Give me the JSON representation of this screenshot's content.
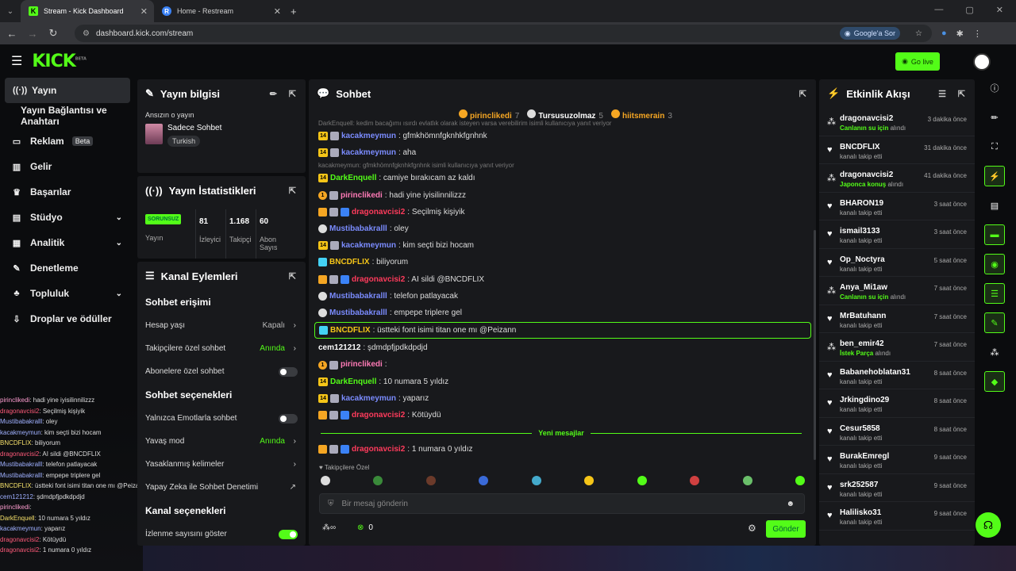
{
  "browser": {
    "tabs": [
      {
        "label": "Stream - Kick Dashboard",
        "active": true
      },
      {
        "label": "Home - Restream",
        "active": false
      }
    ],
    "url": "dashboard.kick.com/stream",
    "google_sor": "Google'a Sor"
  },
  "header": {
    "logo": "KICK",
    "logo_beta": "BETA",
    "go_live": "Go live"
  },
  "sidebar": {
    "items": [
      {
        "label": "Yayın",
        "icon": "broadcast-icon"
      },
      {
        "label": "Yayın Bağlantısı ve Anahtarı",
        "icon": ""
      },
      {
        "label": "Reklam",
        "icon": "ad-icon",
        "badge": "Beta"
      },
      {
        "label": "Gelir",
        "icon": "chart-icon"
      },
      {
        "label": "Başarılar",
        "icon": "trophy-icon"
      },
      {
        "label": "Stüdyo",
        "icon": "studio-icon"
      },
      {
        "label": "Analitik",
        "icon": "analytics-icon"
      },
      {
        "label": "Denetleme",
        "icon": "wrench-icon"
      },
      {
        "label": "Topluluk",
        "icon": "community-icon"
      },
      {
        "label": "Droplar ve ödüller",
        "icon": "drop-icon"
      }
    ]
  },
  "overlay_chat": [
    {
      "user": "pirinclikedi",
      "text": ": hadi yine iyisilinnilizzz"
    },
    {
      "user": "dragonavcisi2",
      "text": ": Seçilmiş kişiyik"
    },
    {
      "user": "Mustibabakralll",
      "text": ": oley"
    },
    {
      "user": "kacakmeymun",
      "text": ": kim seçti bizi hocam"
    },
    {
      "user": "BNCDFLIX",
      "text": ": biliyorum"
    },
    {
      "user": "dragonavcisi2",
      "text": ": AI sildi @BNCDFLIX"
    },
    {
      "user": "Mustibabakralll",
      "text": ": telefon patlayacak"
    },
    {
      "user": "Mustibabakralll",
      "text": ": empepe triplere gel"
    },
    {
      "user": "BNCDFLIX",
      "text": ": üstteki font isimi titan one mı @Peizann"
    },
    {
      "user": "cem121212",
      "text": ": şdmdpfjpdkdpdjd"
    },
    {
      "user": "pirinclikedi",
      "text": ":"
    },
    {
      "user": "DarkEnquell",
      "text": ": 10 numara 5 yıldız"
    },
    {
      "user": "kacakmeymun",
      "text": ": yaparız"
    },
    {
      "user": "dragonavcisi2",
      "text": ": Kötüydü"
    },
    {
      "user": "dragonavcisi2",
      "text": ": 1 numara 0 yıldız"
    }
  ],
  "stream_info": {
    "title": "Yayın bilgisi",
    "subtitle": "Ansızın o yayın",
    "category": "Sadece Sohbet",
    "language": "Turkish"
  },
  "stats": {
    "title": "Yayın İstatistikleri",
    "items": [
      {
        "value": "SORUNSUZ",
        "label": "Yayın"
      },
      {
        "value": "81",
        "label": "İzleyici"
      },
      {
        "value": "1.168",
        "label": "Takipçi"
      },
      {
        "value": "60",
        "label": "Abon Sayıs"
      }
    ]
  },
  "channel_actions": {
    "title": "Kanal Eylemleri",
    "section1": "Sohbet erişimi",
    "rows1": [
      {
        "label": "Hesap yaşı",
        "value": "Kapalı"
      },
      {
        "label": "Takipçilere özel sohbet",
        "value": "Anında"
      },
      {
        "label": "Abonelere özel sohbet",
        "value": ""
      }
    ],
    "section2": "Sohbet seçenekleri",
    "rows2": [
      {
        "label": "Yalnızca Emotlarla sohbet",
        "value": ""
      },
      {
        "label": "Yavaş mod",
        "value": "Anında"
      },
      {
        "label": "Yasaklanmış kelimeler",
        "value": ""
      },
      {
        "label": "Yapay Zeka ile Sohbet Denetimi",
        "value": ""
      }
    ],
    "section3": "Kanal seçenekleri",
    "rows3": [
      {
        "label": "İzlenme sayısını göster",
        "value": ""
      }
    ]
  },
  "chat": {
    "title": "Sohbet",
    "pinned": [
      {
        "name": "pirinclikedi",
        "count": "7",
        "color": "#f5a623"
      },
      {
        "name": "Tursusuzolmaz",
        "count": "5",
        "color": "#dddddd"
      },
      {
        "name": "hiitsmerain",
        "count": "3",
        "color": "#f5a623"
      }
    ],
    "messages": [
      {
        "reply": "DarkEnquell: kedim bacağımı ısırdı evlatlık olarak isteyen varsa verebilirim isimli kullanıcıya yanıt veriyor"
      },
      {
        "badges": [
          "14",
          "x"
        ],
        "user": "kacakmeymun",
        "color": "#7b8cff",
        "text": ": gfmkhömnfgknhkfgnhnk"
      },
      {
        "badges": [
          "14",
          "x"
        ],
        "user": "kacakmeymun",
        "color": "#7b8cff",
        "text": ": aha"
      },
      {
        "reply": "kacakmeymun: gfmkhömnfgknhkfgnhnk isimli kullanıcıya yanıt veriyor"
      },
      {
        "badges": [
          "14"
        ],
        "user": "DarkEnquell",
        "color": "#53fc18",
        "text": ": camiye bırakıcam az kaldı"
      },
      {
        "badges": [
          "1",
          "x"
        ],
        "user": "pirinclikedi",
        "color": "#ff7ab6",
        "text": ": hadi yine iyisilinnilizzz"
      },
      {
        "badges": [
          "c",
          "x",
          "b"
        ],
        "user": "dragonavcisi2",
        "color": "#ff3b5c",
        "text": ": Seçilmiş kişiyik"
      },
      {
        "badges": [
          "s"
        ],
        "user": "Mustibabakralll",
        "color": "#7b8cff",
        "text": ": oley"
      },
      {
        "badges": [
          "14",
          "x"
        ],
        "user": "kacakmeymun",
        "color": "#7b8cff",
        "text": ": kim seçti bizi hocam"
      },
      {
        "badges": [
          "m"
        ],
        "user": "BNCDFLIX",
        "color": "#f5c518",
        "text": ": biliyorum"
      },
      {
        "badges": [
          "c",
          "x",
          "b"
        ],
        "user": "dragonavcisi2",
        "color": "#ff3b5c",
        "text": ": AI sildi @BNCDFLIX"
      },
      {
        "badges": [
          "s"
        ],
        "user": "Mustibabakralll",
        "color": "#7b8cff",
        "text": ": telefon patlayacak"
      },
      {
        "badges": [
          "s"
        ],
        "user": "Mustibabakralll",
        "color": "#7b8cff",
        "text": ": empepe triplere gel"
      },
      {
        "badges": [
          "m"
        ],
        "user": "BNCDFLIX",
        "color": "#f5c518",
        "text": ": üstteki font isimi titan one mı @Peizann",
        "highlight": true
      },
      {
        "badges": [],
        "user": "cem121212",
        "color": "#ffffff",
        "text": ": şdmdpfjpdkdpdjd"
      },
      {
        "badges": [
          "1",
          "x"
        ],
        "user": "pirinclikedi",
        "color": "#ff7ab6",
        "text": ":"
      },
      {
        "badges": [
          "14"
        ],
        "user": "DarkEnquell",
        "color": "#53fc18",
        "text": ": 10 numara 5 yıldız"
      },
      {
        "badges": [
          "14",
          "x"
        ],
        "user": "kacakmeymun",
        "color": "#7b8cff",
        "text": ": yaparız"
      },
      {
        "badges": [
          "c",
          "x",
          "b"
        ],
        "user": "dragonavcisi2",
        "color": "#ff3b5c",
        "text": ": Kötüydü"
      }
    ],
    "new_messages": "Yeni mesajlar",
    "last_message": {
      "badges": [
        "c",
        "x",
        "b"
      ],
      "user": "dragonavcisi2",
      "color": "#ff3b5c",
      "text": ": 1 numara 0 yıldız"
    },
    "followers_only": "Takipçilere Özel",
    "placeholder": "Bir mesaj gönderin",
    "points": "0",
    "send": "Gönder"
  },
  "activity": {
    "title": "Etkinlik Akışı",
    "items": [
      {
        "icon": "gift-icon",
        "name": "dragonavcisi2",
        "sub_hl": "Canlanın su için",
        "sub": " alındı",
        "time": "3 dakika önce"
      },
      {
        "icon": "heart-icon",
        "name": "BNCDFLIX",
        "sub_hl": "",
        "sub": "kanalı takip etti",
        "time": "31 dakika önce"
      },
      {
        "icon": "gift-icon",
        "name": "dragonavcisi2",
        "sub_hl": "Japonca konuş",
        "sub": " alındı",
        "time": "41 dakika önce"
      },
      {
        "icon": "heart-icon",
        "name": "BHARON19",
        "sub_hl": "",
        "sub": "kanalı takip etti",
        "time": "3 saat önce"
      },
      {
        "icon": "heart-icon",
        "name": "ismail3133",
        "sub_hl": "",
        "sub": "kanalı takip etti",
        "time": "3 saat önce"
      },
      {
        "icon": "heart-icon",
        "name": "Op_Noctyra",
        "sub_hl": "",
        "sub": "kanalı takip etti",
        "time": "5 saat önce"
      },
      {
        "icon": "gift-icon",
        "name": "Anya_Mi1aw",
        "sub_hl": "Canlanın su için",
        "sub": " alındı",
        "time": "7 saat önce"
      },
      {
        "icon": "heart-icon",
        "name": "MrBatuhann",
        "sub_hl": "",
        "sub": "kanalı takip etti",
        "time": "7 saat önce"
      },
      {
        "icon": "gift-icon",
        "name": "ben_emir42",
        "sub_hl": "İstek Parça",
        "sub": " alındı",
        "time": "7 saat önce"
      },
      {
        "icon": "heart-icon",
        "name": "Babanehoblatan31",
        "sub_hl": "",
        "sub": "kanalı takip etti",
        "time": "8 saat önce"
      },
      {
        "icon": "heart-icon",
        "name": "Jrkingdino29",
        "sub_hl": "",
        "sub": "kanalı takip etti",
        "time": "8 saat önce"
      },
      {
        "icon": "heart-icon",
        "name": "Cesur5858",
        "sub_hl": "",
        "sub": "kanalı takip etti",
        "time": "8 saat önce"
      },
      {
        "icon": "heart-icon",
        "name": "BurakEmregl",
        "sub_hl": "",
        "sub": "kanalı takip etti",
        "time": "9 saat önce"
      },
      {
        "icon": "heart-icon",
        "name": "srk252587",
        "sub_hl": "",
        "sub": "kanalı takip etti",
        "time": "9 saat önce"
      },
      {
        "icon": "heart-icon",
        "name": "Halilisko31",
        "sub_hl": "",
        "sub": "kanalı takip etti",
        "time": "9 saat önce"
      }
    ]
  },
  "colors": {
    "accent": "#53fc18",
    "panel": "#18191c",
    "bg": "#0b0c0e"
  }
}
